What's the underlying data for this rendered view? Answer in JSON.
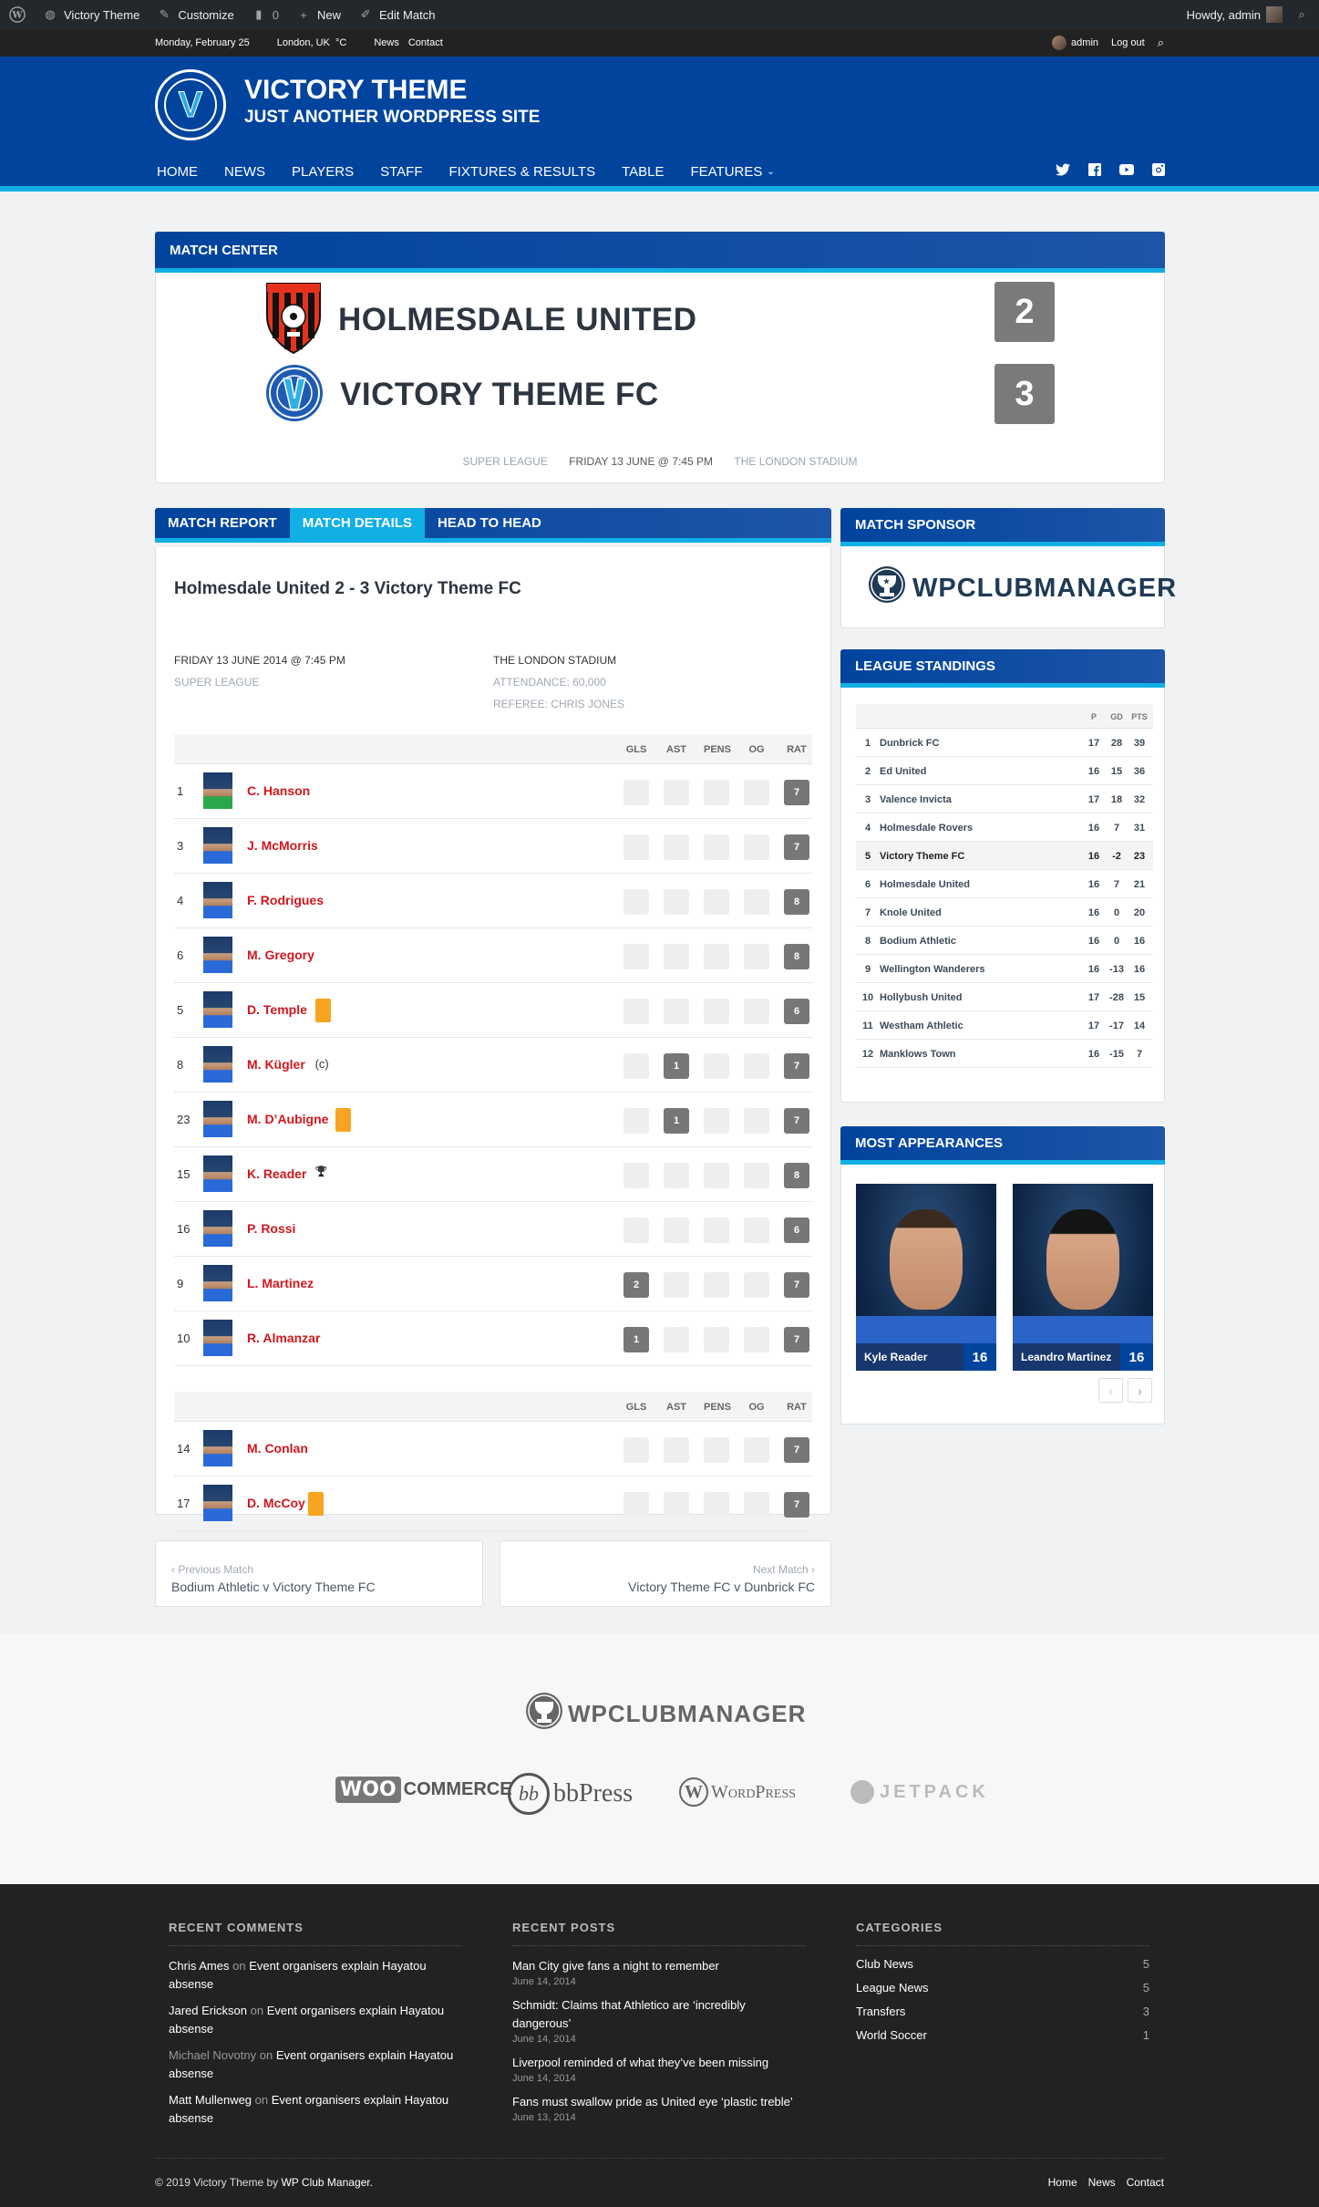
{
  "admin_bar": {
    "site_name": "Victory Theme",
    "customize": "Customize",
    "comments_count": "0",
    "new_label": "New",
    "edit_label": "Edit Match",
    "howdy": "Howdy, admin"
  },
  "top_strip": {
    "date": "Monday, February 25",
    "location": "London, UK",
    "unit": "°C",
    "links": [
      "News",
      "Contact"
    ],
    "user": "admin",
    "logout": "Log out"
  },
  "header": {
    "logo_letter": "V",
    "site_title": "VICTORY THEME",
    "site_description": "JUST ANOTHER WORDPRESS SITE",
    "nav": [
      "HOME",
      "NEWS",
      "PLAYERS",
      "STAFF",
      "FIXTURES & RESULTS",
      "TABLE",
      "FEATURES"
    ],
    "social": [
      "twitter-icon",
      "facebook-icon",
      "youtube-icon",
      "instagram-icon"
    ]
  },
  "match_center": {
    "title": "MATCH CENTER",
    "home_team": "HOLMESDALE UNITED",
    "home_score": "2",
    "away_team": "VICTORY THEME FC",
    "away_score": "3",
    "competition": "SUPER LEAGUE",
    "datetime": "FRIDAY 13 JUNE @ 7:45 PM",
    "venue": "THE LONDON STADIUM"
  },
  "tabs": [
    "MATCH REPORT",
    "MATCH DETAILS",
    "HEAD TO HEAD"
  ],
  "match_details": {
    "title": "Holmesdale United 2 - 3 Victory Theme FC",
    "datetime": "FRIDAY 13 JUNE 2014 @ 7:45 PM",
    "competition": "SUPER LEAGUE",
    "venue": "THE LONDON STADIUM",
    "attendance": "ATTENDANCE: 60,000",
    "referee": "REFEREE: CHRIS JONES",
    "columns": [
      "GLS",
      "AST",
      "PENS",
      "OG",
      "RAT"
    ],
    "starters": [
      {
        "num": "1",
        "name": "C. Hanson",
        "extra": "",
        "gls": "",
        "ast": "",
        "pens": "",
        "og": "",
        "rat": "7",
        "kit": "green"
      },
      {
        "num": "3",
        "name": "J. McMorris",
        "extra": "",
        "gls": "",
        "ast": "",
        "pens": "",
        "og": "",
        "rat": "7"
      },
      {
        "num": "4",
        "name": "F. Rodrigues",
        "extra": "",
        "gls": "",
        "ast": "",
        "pens": "",
        "og": "",
        "rat": "8"
      },
      {
        "num": "6",
        "name": "M. Gregory",
        "extra": "",
        "gls": "",
        "ast": "",
        "pens": "",
        "og": "",
        "rat": "8"
      },
      {
        "num": "5",
        "name": "D. Temple",
        "extra": "yellow-card",
        "gls": "",
        "ast": "",
        "pens": "",
        "og": "",
        "rat": "6"
      },
      {
        "num": "8",
        "name": "M. Kügler",
        "extra": "(c)",
        "gls": "",
        "ast": "1",
        "pens": "",
        "og": "",
        "rat": "7"
      },
      {
        "num": "23",
        "name": "M. D’Aubigne",
        "extra": "yellow-card",
        "gls": "",
        "ast": "1",
        "pens": "",
        "og": "",
        "rat": "7"
      },
      {
        "num": "15",
        "name": "K. Reader",
        "extra": "trophy-icon",
        "gls": "",
        "ast": "",
        "pens": "",
        "og": "",
        "rat": "8"
      },
      {
        "num": "16",
        "name": "P. Rossi",
        "extra": "",
        "gls": "",
        "ast": "",
        "pens": "",
        "og": "",
        "rat": "6"
      },
      {
        "num": "9",
        "name": "L. Martinez",
        "extra": "",
        "gls": "2",
        "ast": "",
        "pens": "",
        "og": "",
        "rat": "7"
      },
      {
        "num": "10",
        "name": "R. Almanzar",
        "extra": "",
        "gls": "1",
        "ast": "",
        "pens": "",
        "og": "",
        "rat": "7"
      }
    ],
    "subs": [
      {
        "num": "14",
        "name": "M. Conlan",
        "extra": "",
        "gls": "",
        "ast": "",
        "pens": "",
        "og": "",
        "rat": "7"
      },
      {
        "num": "17",
        "name": "D. McCoy",
        "extra": "yellow-card",
        "gls": "",
        "ast": "",
        "pens": "",
        "og": "",
        "rat": "7"
      }
    ]
  },
  "pagination": {
    "prev_label": "Previous Match",
    "prev_title": "Bodium Athletic v Victory Theme FC",
    "next_label": "Next Match",
    "next_title": "Victory Theme FC v Dunbrick FC"
  },
  "sidebar": {
    "sponsor_title": "MATCH SPONSOR",
    "sponsor_name": "WPCLUBMANAGER",
    "standings_title": "LEAGUE STANDINGS",
    "standings_columns": [
      "P",
      "GD",
      "PTS"
    ],
    "standings": [
      {
        "pos": "1",
        "team": "Dunbrick FC",
        "p": "17",
        "gd": "28",
        "pts": "39"
      },
      {
        "pos": "2",
        "team": "Ed United",
        "p": "16",
        "gd": "15",
        "pts": "36"
      },
      {
        "pos": "3",
        "team": "Valence Invicta",
        "p": "17",
        "gd": "18",
        "pts": "32"
      },
      {
        "pos": "4",
        "team": "Holmesdale Rovers",
        "p": "16",
        "gd": "7",
        "pts": "31"
      },
      {
        "pos": "5",
        "team": "Victory Theme FC",
        "p": "16",
        "gd": "-2",
        "pts": "23",
        "highlight": true
      },
      {
        "pos": "6",
        "team": "Holmesdale United",
        "p": "16",
        "gd": "7",
        "pts": "21"
      },
      {
        "pos": "7",
        "team": "Knole United",
        "p": "16",
        "gd": "0",
        "pts": "20"
      },
      {
        "pos": "8",
        "team": "Bodium Athletic",
        "p": "16",
        "gd": "0",
        "pts": "16"
      },
      {
        "pos": "9",
        "team": "Wellington Wanderers",
        "p": "16",
        "gd": "-13",
        "pts": "16"
      },
      {
        "pos": "10",
        "team": "Hollybush United",
        "p": "17",
        "gd": "-28",
        "pts": "15"
      },
      {
        "pos": "11",
        "team": "Westham Athletic",
        "p": "17",
        "gd": "-17",
        "pts": "14"
      },
      {
        "pos": "12",
        "team": "Manklows Town",
        "p": "16",
        "gd": "-15",
        "pts": "7"
      }
    ],
    "appearances_title": "MOST APPEARANCES",
    "appearances": [
      {
        "name": "Kyle Reader",
        "value": "16"
      },
      {
        "name": "Leandro Martinez",
        "value": "16"
      }
    ]
  },
  "sponsors": {
    "main": "WPCLUBMANAGER",
    "logos": [
      "WOO COMMERCE",
      "bbPress",
      "WordPress",
      "JETPACK"
    ]
  },
  "footer": {
    "recent_comments_title": "RECENT COMMENTS",
    "recent_comments": [
      {
        "author": "Chris Ames",
        "on": "on",
        "post": "Event organisers explain Hayatou absense"
      },
      {
        "author": "Jared Erickson",
        "on": "on",
        "post": "Event organisers explain Hayatou absense"
      },
      {
        "author": "Michael Novotny",
        "on": "on",
        "post": "Event organisers explain Hayatou absense",
        "muted_author": true
      },
      {
        "author": "Matt Mullenweg",
        "on": "on",
        "post": "Event organisers explain Hayatou absense"
      }
    ],
    "recent_posts_title": "RECENT POSTS",
    "recent_posts": [
      {
        "title": "Man City give fans a night to remember",
        "date": "June 14, 2014"
      },
      {
        "title": "Schmidt: Claims that Athletico are ‘incredibly dangerous’",
        "date": "June 14, 2014"
      },
      {
        "title": "Liverpool reminded of what they’ve been missing",
        "date": "June 14, 2014"
      },
      {
        "title": "Fans must swallow pride as United eye ‘plastic treble’",
        "date": "June 13, 2014"
      }
    ],
    "categories_title": "CATEGORIES",
    "categories": [
      {
        "name": "Club News",
        "count": "5"
      },
      {
        "name": "League News",
        "count": "5"
      },
      {
        "name": "Transfers",
        "count": "3"
      },
      {
        "name": "World Soccer",
        "count": "1"
      }
    ],
    "copyright_prefix": "© 2019 Victory Theme by ",
    "copyright_link": "WP Club Manager.",
    "links": [
      "Home",
      "News",
      "Contact"
    ]
  }
}
